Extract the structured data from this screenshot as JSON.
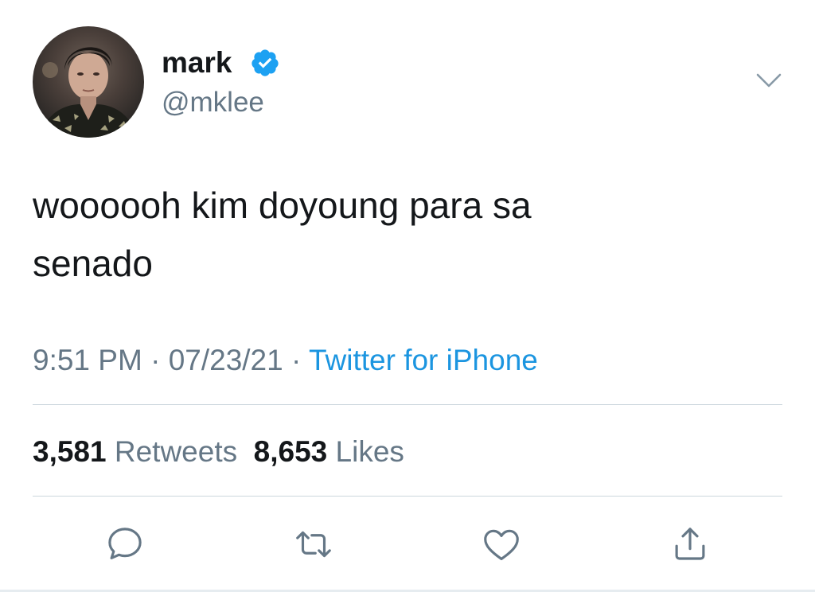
{
  "author": {
    "display_name": "mark",
    "handle": "@mklee",
    "verified_icon": "verified-badge-icon",
    "avatar": "profile-photo"
  },
  "tweet": {
    "text_line1": "woooooh kim doyoung para sa",
    "text_line2": "senado",
    "time": "9:51 PM",
    "date": "07/23/21",
    "separator": "·",
    "source": "Twitter for iPhone"
  },
  "stats": {
    "retweets_count": "3,581",
    "retweets_label": "Retweets",
    "likes_count": "8,653",
    "likes_label": "Likes"
  },
  "actions": [
    "reply-icon",
    "retweet-icon",
    "like-icon",
    "share-icon"
  ],
  "colors": {
    "text": "#14171a",
    "secondary": "#657786",
    "link": "#1b95e0",
    "verified": "#1da1f2",
    "divider": "#ccd6dd"
  }
}
